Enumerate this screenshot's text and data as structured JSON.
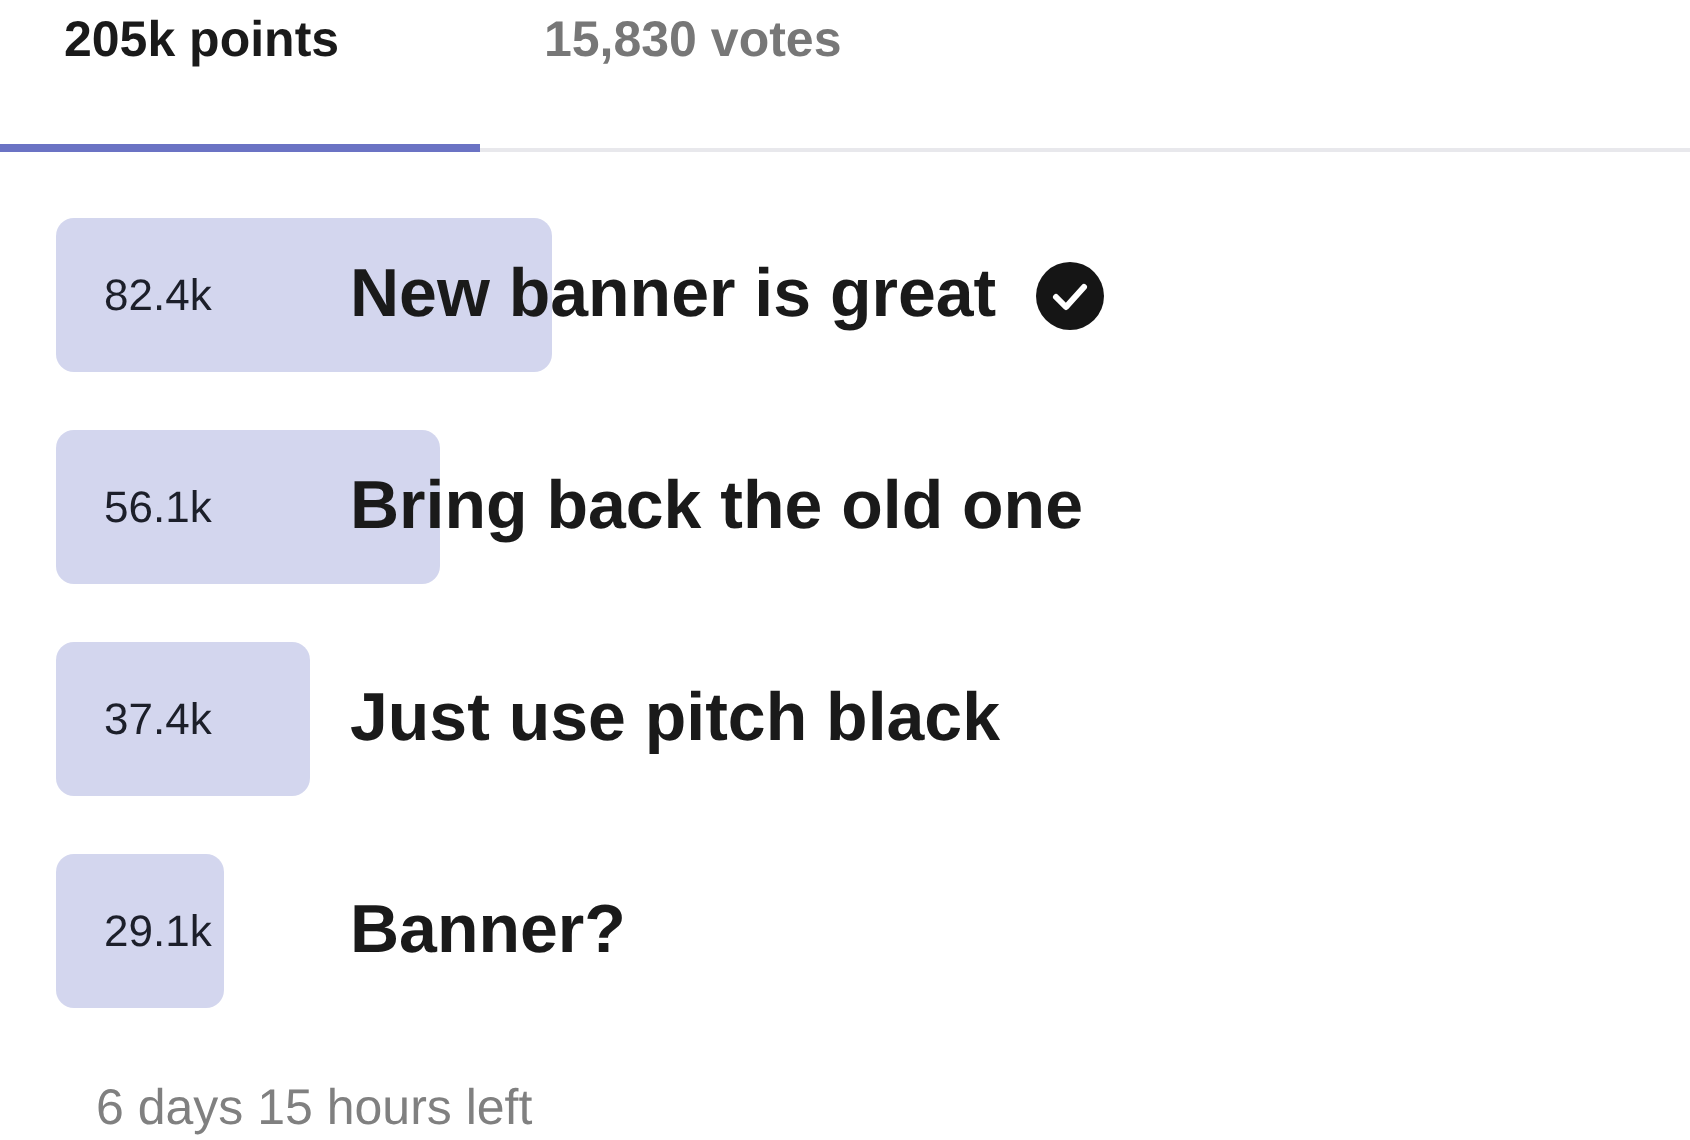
{
  "tabs": [
    {
      "label": "205k points",
      "selected": true
    },
    {
      "label": "15,830 votes",
      "selected": false
    }
  ],
  "options": [
    {
      "count": "82.4k",
      "label": "New banner is great",
      "chosen": true
    },
    {
      "count": "56.1k",
      "label": "Bring back the old one",
      "chosen": false
    },
    {
      "count": "37.4k",
      "label": "Just use pitch black",
      "chosen": false
    },
    {
      "count": "29.1k",
      "label": "Banner?",
      "chosen": false
    }
  ],
  "footer": "6 days 15 hours left"
}
